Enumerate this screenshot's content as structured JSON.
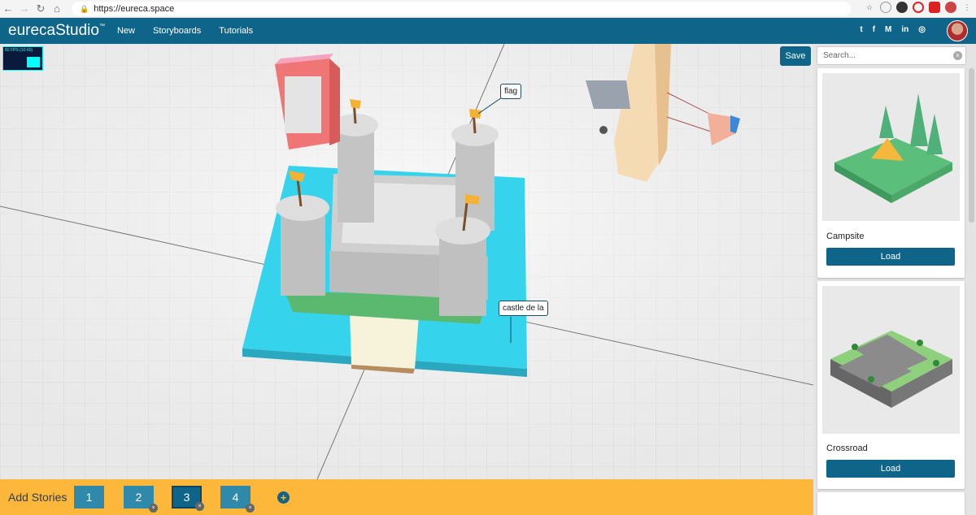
{
  "browser": {
    "url": "https://eureca.space",
    "back_icon": "arrow-left-icon",
    "forward_icon": "arrow-right-icon",
    "reload_icon": "reload-icon",
    "home_icon": "home-icon"
  },
  "app": {
    "logo": "eurecaStudio",
    "logo_mark": "™",
    "nav": [
      "New",
      "Storyboards",
      "Tutorials"
    ],
    "social": [
      "twitter-icon",
      "facebook-icon",
      "medium-icon",
      "linkedin-icon",
      "instagram-icon"
    ],
    "social_glyphs": [
      "t",
      "f",
      "M",
      "in",
      "◎"
    ],
    "brand_color": "#0f6589",
    "accent_color": "#fdb73a"
  },
  "viewport": {
    "fps": "60 FPS (10-60)",
    "labels": [
      "flag",
      "castle de la"
    ],
    "save_label": "Save"
  },
  "sidebar": {
    "search_placeholder": "Search...",
    "clear_glyph": "×",
    "cards": [
      {
        "title": "Campsite",
        "load_label": "Load"
      },
      {
        "title": "Crossroad",
        "load_label": "Load"
      }
    ]
  },
  "stories": {
    "title": "Add Stories",
    "items": [
      "1",
      "2",
      "3",
      "4"
    ],
    "active": "3",
    "delete_glyph": "×",
    "add_glyph": "+"
  }
}
